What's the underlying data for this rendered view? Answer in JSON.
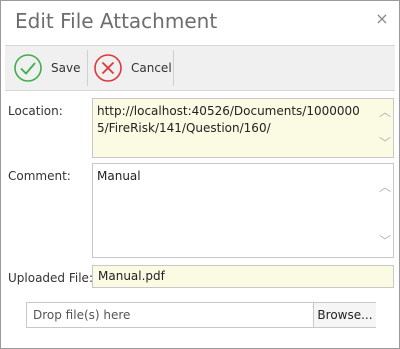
{
  "dialog": {
    "title": "Edit File Attachment",
    "close_glyph": "×"
  },
  "toolbar": {
    "save_label": "Save",
    "save_icon": "check-circle-icon",
    "cancel_label": "Cancel",
    "cancel_icon": "x-circle-icon"
  },
  "form": {
    "location_label": "Location:",
    "location_value": "http://localhost:40526/Documents/10000005/FireRisk/141/Question/160/",
    "comment_label": "Comment:",
    "comment_value": "Manual",
    "uploaded_label": "Uploaded File:",
    "required_mark": "*",
    "uploaded_value": "Manual.pdf",
    "drop_placeholder": "Drop file(s) here",
    "browse_label": "Browse..."
  },
  "colors": {
    "readonly_bg": "#fbfbe3",
    "save_green": "#3db04b",
    "cancel_red": "#e0383a",
    "required_red": "#d00000"
  }
}
